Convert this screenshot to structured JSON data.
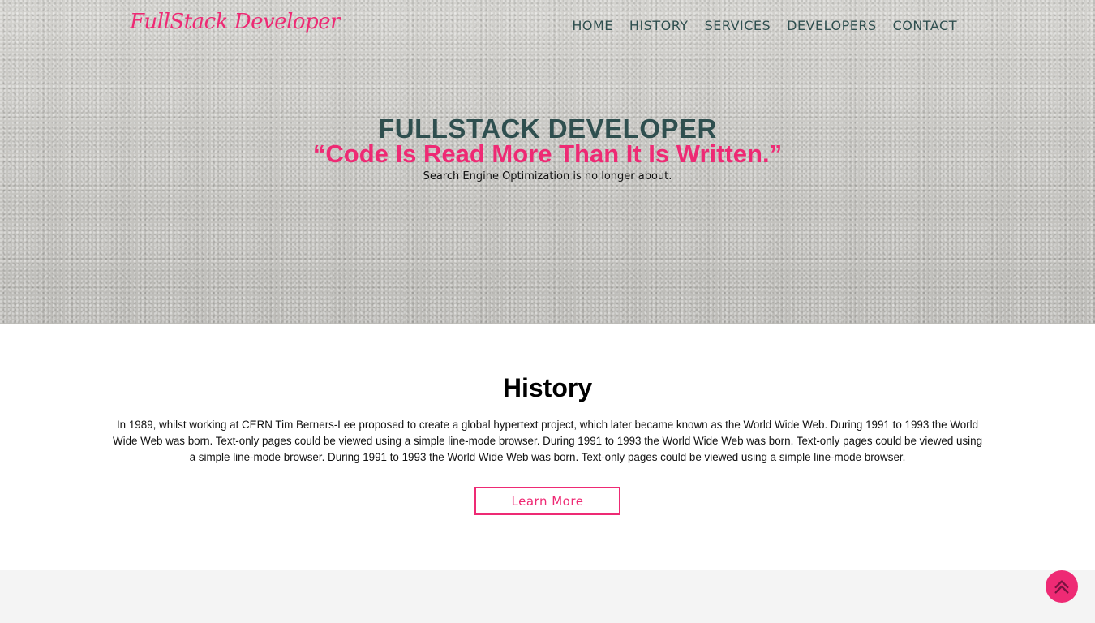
{
  "header": {
    "logo": "FullStack Developer",
    "nav": [
      "HOME",
      "HISTORY",
      "SERVICES",
      "DEVELOPERS",
      "CONTACT"
    ]
  },
  "hero": {
    "title": "FULLSTACK DEVELOPER",
    "quote": "“Code Is Read More Than It Is Written.”",
    "subtitle": "Search Engine Optimization is no longer about."
  },
  "history": {
    "heading": "History",
    "body": "In 1989, whilst working at CERN Tim Berners-Lee proposed to create a global hypertext project, which later became known as the World Wide Web. During 1991 to 1993 the World Wide Web was born. Text-only pages could be viewed using a simple line-mode browser. During 1991 to 1993 the World Wide Web was born. Text-only pages could be viewed using a simple line-mode browser. During 1991 to 1993 the World Wide Web was born. Text-only pages could be viewed using a simple line-mode browser.",
    "button": "Learn More"
  },
  "scroll_top": {
    "icon": "double-chevron-up-icon"
  },
  "colors": {
    "accent": "#ee2a74",
    "nav_text": "#2f4f4f",
    "section_bg": "#f4f4f4"
  }
}
